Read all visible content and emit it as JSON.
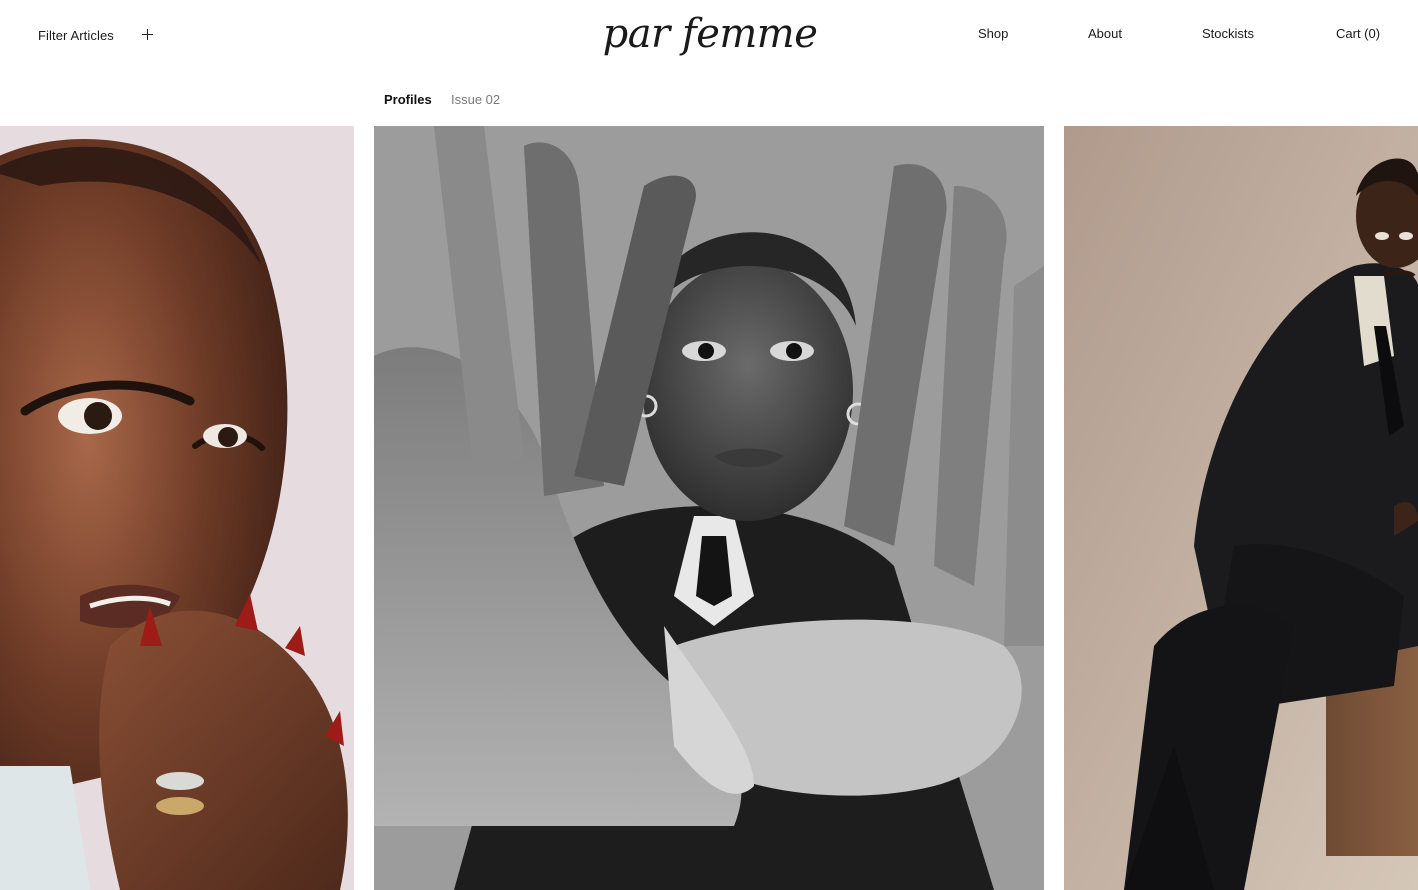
{
  "header": {
    "filter_label": "Filter Articles",
    "filter_icon": "plus-icon",
    "logo_text": "par femme"
  },
  "nav": {
    "items": [
      {
        "label": "Shop"
      },
      {
        "label": "About"
      },
      {
        "label": "Stockists"
      },
      {
        "label": "Cart (0)"
      }
    ]
  },
  "tabs": {
    "items": [
      {
        "label": "Profiles",
        "active": true
      },
      {
        "label": "Issue 02",
        "active": false
      }
    ]
  },
  "gallery": {
    "photos": [
      {
        "subject": "close-up-portrait-red-nails",
        "background": "#e7dce0"
      },
      {
        "subject": "black-and-white-portrait-hands",
        "background": "#a4a4a4"
      },
      {
        "subject": "seated-figure-dark-suit",
        "background": "#b69f8f"
      }
    ]
  },
  "colors": {
    "text": "#1a1a1a",
    "muted": "#7a7a7a",
    "page_background": "#ffffff"
  }
}
